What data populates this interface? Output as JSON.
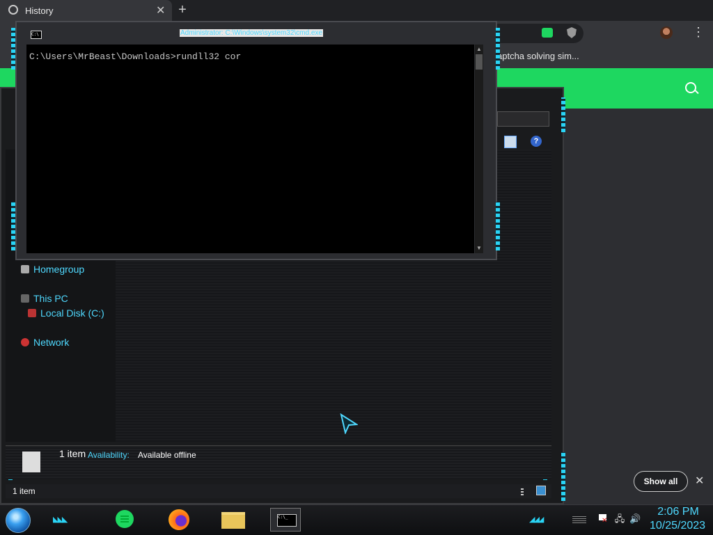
{
  "browser": {
    "tab_title": "History",
    "tab_close": "✕",
    "new_tab": "+",
    "bookmark_text": "aptcha solving sim...",
    "menu": "⋮",
    "show_all_label": "Show all",
    "show_all_close": "✕",
    "colors": {
      "accent_green": "#1ed760",
      "dark": "#202124"
    }
  },
  "explorer": {
    "nav": {
      "homegroup": "Homegroup",
      "this_pc": "This PC",
      "local_disk": "Local Disk (C:)",
      "network": "Network"
    },
    "details": {
      "count": "1 item",
      "availability_label": "Availability:",
      "availability_value": "Available offline"
    },
    "status_text": "1 item",
    "help_icon": "?",
    "accent": "#4fd9ff"
  },
  "cmd": {
    "title": "Administrator: C:\\Windows\\system32\\cmd.exe",
    "icon_text": "C:\\",
    "line": "C:\\Users\\MrBeast\\Downloads>rundll32 cor",
    "scroll_up": "▲",
    "scroll_down": "▼"
  },
  "taskbar": {
    "chevrons": "◣◣◣",
    "chevrons_right": "◢◢◢",
    "cmd_icon_text": "C:\\_",
    "tray_network_icon": "🖧",
    "tray_volume_icon": "🔊",
    "clock_time": "2:06 PM",
    "clock_date": "10/25/2023"
  }
}
